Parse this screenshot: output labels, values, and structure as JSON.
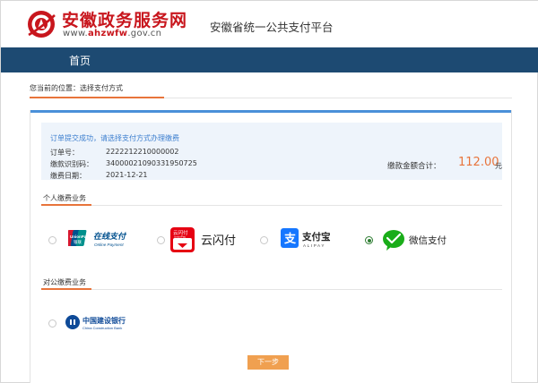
{
  "header": {
    "site_title": "安徽政务服务网",
    "domain_prefix": "www.",
    "domain_highlight": "ahzwfw",
    "domain_suffix": ".gov.cn",
    "platform_title": "安徽省统一公共支付平台"
  },
  "nav": {
    "home": "首页"
  },
  "breadcrumb": "您当前的位置：选择支付方式",
  "order": {
    "message": "订单提交成功，请选择支付方式办理缴费",
    "order_no_label": "订单号：",
    "order_no": "2222212210000002",
    "payment_code_label": "缴款识别码：",
    "payment_code": "340000210903319507​25",
    "date_label": "缴费日期：",
    "date": "2021-12-21",
    "amount_label": "缴款金额合计：",
    "amount": "112.00",
    "amount_unit": "元"
  },
  "sections": {
    "personal": "个人缴费业务",
    "corporate": "对公缴费业务"
  },
  "pay_methods": {
    "unionpay_brand": "UnionPay",
    "unionpay_sub": "银联",
    "unionpay_text": "在线支付",
    "unionpay_en": "Online Payment",
    "cloudpay_badge": "云闪付",
    "cloudpay_badge_en": "UnionPay",
    "cloudpay_text": "云闪付",
    "alipay_text": "支付宝",
    "alipay_en": "ALIPAY",
    "wechat_text": "微信支付",
    "ccb_text": "中国建设银行",
    "ccb_en": "China Construction Bank",
    "selected": "wechat"
  },
  "actions": {
    "next": "下一步"
  },
  "colors": {
    "brand_red": "#c8161d",
    "nav_blue": "#1d4a72",
    "accent_orange": "#e8743b",
    "info_blue": "#3d7fcf",
    "wechat_green": "#1aad19",
    "alipay_blue": "#1677ff",
    "ccb_blue": "#0e4a98"
  }
}
